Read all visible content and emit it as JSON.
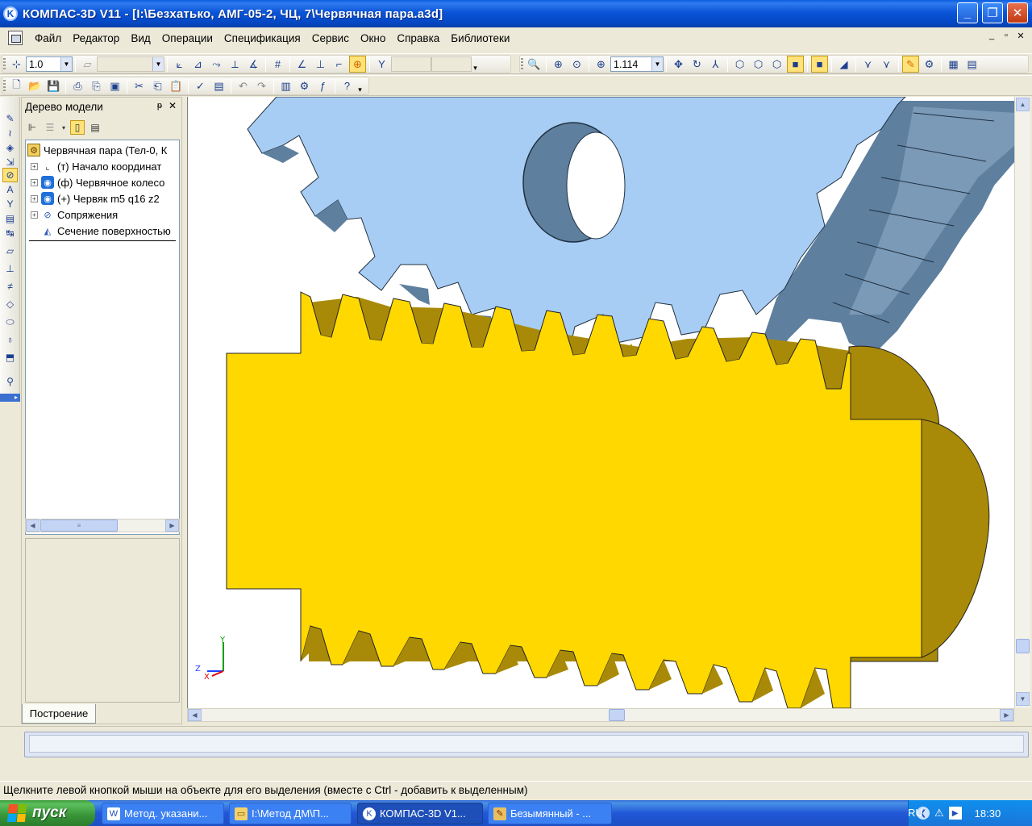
{
  "window": {
    "title": "КОМПАС-3D V11 - [I:\\Безхатько, АМГ-05-2, ЧЦ, 7\\Червячная пара.a3d]",
    "app_icon": "kompas-logo-icon",
    "minimize": "_",
    "maximize": "❐",
    "close": "✕"
  },
  "menu": {
    "items": [
      "Файл",
      "Редактор",
      "Вид",
      "Операции",
      "Спецификация",
      "Сервис",
      "Окно",
      "Справка",
      "Библиотеки"
    ],
    "mdi_buttons": [
      "_",
      "▫",
      "✕"
    ]
  },
  "toolbar_top": {
    "scale_value": "1.0",
    "zoom_value": "1.114"
  },
  "tree": {
    "title": "Дерево модели",
    "pin": "ᵽ",
    "close": "✕",
    "items": [
      {
        "label": "Червячная пара (Тел-0, К",
        "icon": "assembly-icon",
        "expander": ""
      },
      {
        "label": "(т) Начало координат",
        "icon": "origin-icon",
        "expander": "+"
      },
      {
        "label": "(ф) Червячное колесо",
        "icon": "part-icon",
        "expander": "+"
      },
      {
        "label": "(+) Червяк m5 q16 z2",
        "icon": "part-icon",
        "expander": "+"
      },
      {
        "label": "Сопряжения",
        "icon": "mates-icon",
        "expander": "+"
      },
      {
        "label": "Сечение поверхностью",
        "icon": "section-icon",
        "expander": ""
      }
    ],
    "tab_label": "Построение"
  },
  "viewport": {
    "axis_labels": {
      "x": "X",
      "y": "Y",
      "z": "Z"
    },
    "colors": {
      "background": "#ffffff",
      "wheel": "#a8cdf4",
      "wheel_shadow": "#5e7f9e",
      "worm": "#ffd800",
      "worm_dark": "#a98a08"
    }
  },
  "status": {
    "message": "Щелкните левой кнопкой мыши на объекте для его выделения (вместе с Ctrl - добавить к выделенным)"
  },
  "taskbar": {
    "start_label": "пуск",
    "tasks": [
      {
        "label": "Метод. указани...",
        "icon": "word-doc-icon",
        "active": false
      },
      {
        "label": "I:\\Метод ДМ\\П...",
        "icon": "folder-icon",
        "active": false
      },
      {
        "label": "КОМПАС-3D V1...",
        "icon": "kompas-logo-icon",
        "active": true
      },
      {
        "label": "Безымянный - ...",
        "icon": "paint-icon",
        "active": false
      }
    ],
    "language": "RU",
    "clock": "18:30"
  }
}
